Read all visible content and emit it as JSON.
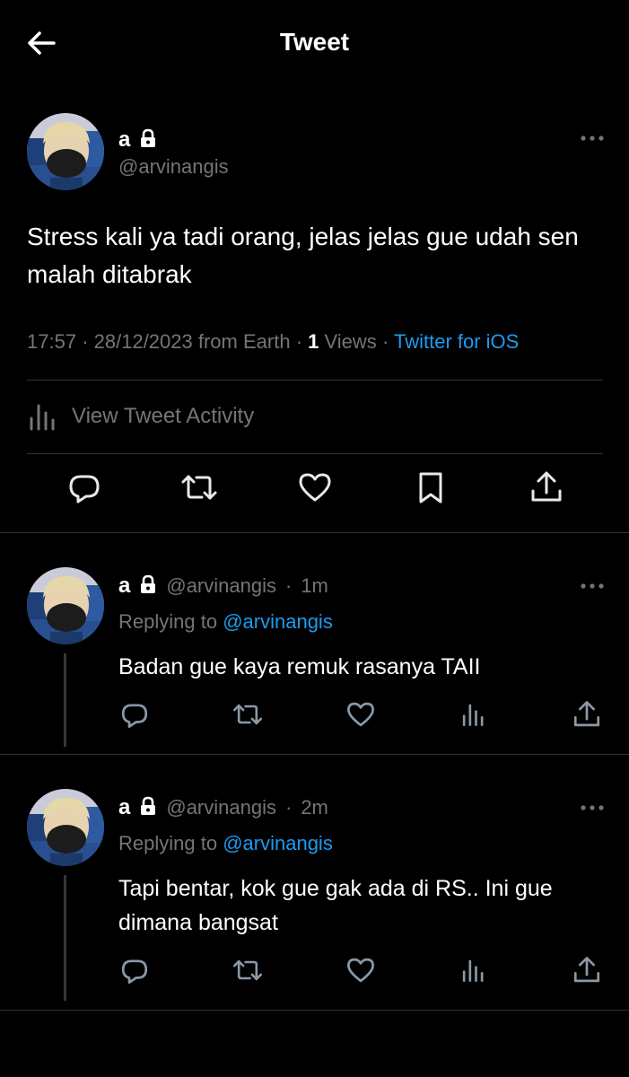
{
  "header": {
    "title": "Tweet",
    "back_icon": "arrow-left-icon"
  },
  "main_tweet": {
    "author_name": "a",
    "author_handle": "@arvinangis",
    "text": "Stress kali ya tadi orang, jelas jelas gue udah sen malah ditabrak",
    "time": "17:57",
    "date": "28/12/2023 from Earth",
    "views_count": "1",
    "views_label": "Views",
    "source": "Twitter for iOS",
    "activity_label": "View Tweet Activity",
    "actions": [
      "reply-icon",
      "retweet-icon",
      "like-icon",
      "bookmark-icon",
      "share-icon"
    ]
  },
  "replies": [
    {
      "author_name": "a",
      "author_handle": "@arvinangis",
      "time_ago": "1m",
      "replying_label": "Replying to",
      "replying_to": "@arvinangis",
      "text": "Badan gue kaya remuk rasanya TAII"
    },
    {
      "author_name": "a",
      "author_handle": "@arvinangis",
      "time_ago": "2m",
      "replying_label": "Replying to",
      "replying_to": "@arvinangis",
      "text": "Tapi bentar, kok gue gak ada di RS.. Ini gue dimana bangsat"
    }
  ],
  "colors": {
    "background": "#000000",
    "text": "#e7e9ea",
    "secondary": "#71767b",
    "accent": "#1d9bf0",
    "divider": "#2f3336"
  }
}
